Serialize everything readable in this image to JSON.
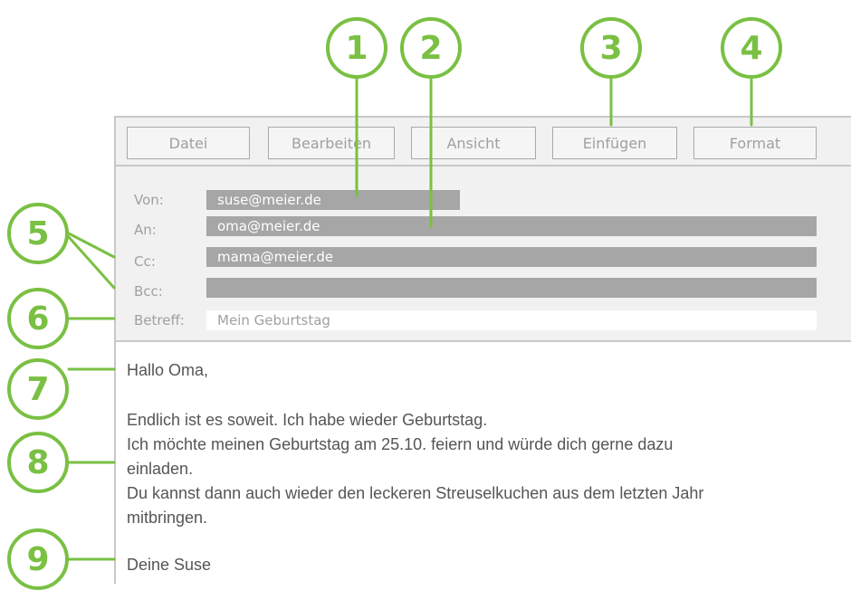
{
  "colors": {
    "accent": "#7ac043",
    "field_fill": "#a6a6a6",
    "panel_background": "#f1f1f1"
  },
  "menu": [
    "Datei",
    "Bearbeiten",
    "Ansicht",
    "Einfügen",
    "Format"
  ],
  "header": {
    "from_label": "Von:",
    "from_value": "suse@meier.de",
    "to_label": "An:",
    "to_value": "oma@meier.de",
    "cc_label": "Cc:",
    "cc_value": "mama@meier.de",
    "bcc_label": "Bcc:",
    "bcc_value": "",
    "subject_label": "Betreff:",
    "subject_value": "Mein Geburtstag"
  },
  "body": {
    "greeting": "Hallo Oma,",
    "lines": [
      "Endlich ist es soweit. Ich habe wieder Geburtstag.",
      "Ich möchte meinen Geburtstag am 25.10. feiern und würde dich gerne dazu",
      "einladen.",
      "Du kannst dann auch wieder den leckeren Streuselkuchen aus dem letzten Jahr",
      "mitbringen."
    ],
    "signature": "Deine Suse"
  },
  "callouts": [
    "1",
    "2",
    "3",
    "4",
    "5",
    "6",
    "7",
    "8",
    "9"
  ]
}
